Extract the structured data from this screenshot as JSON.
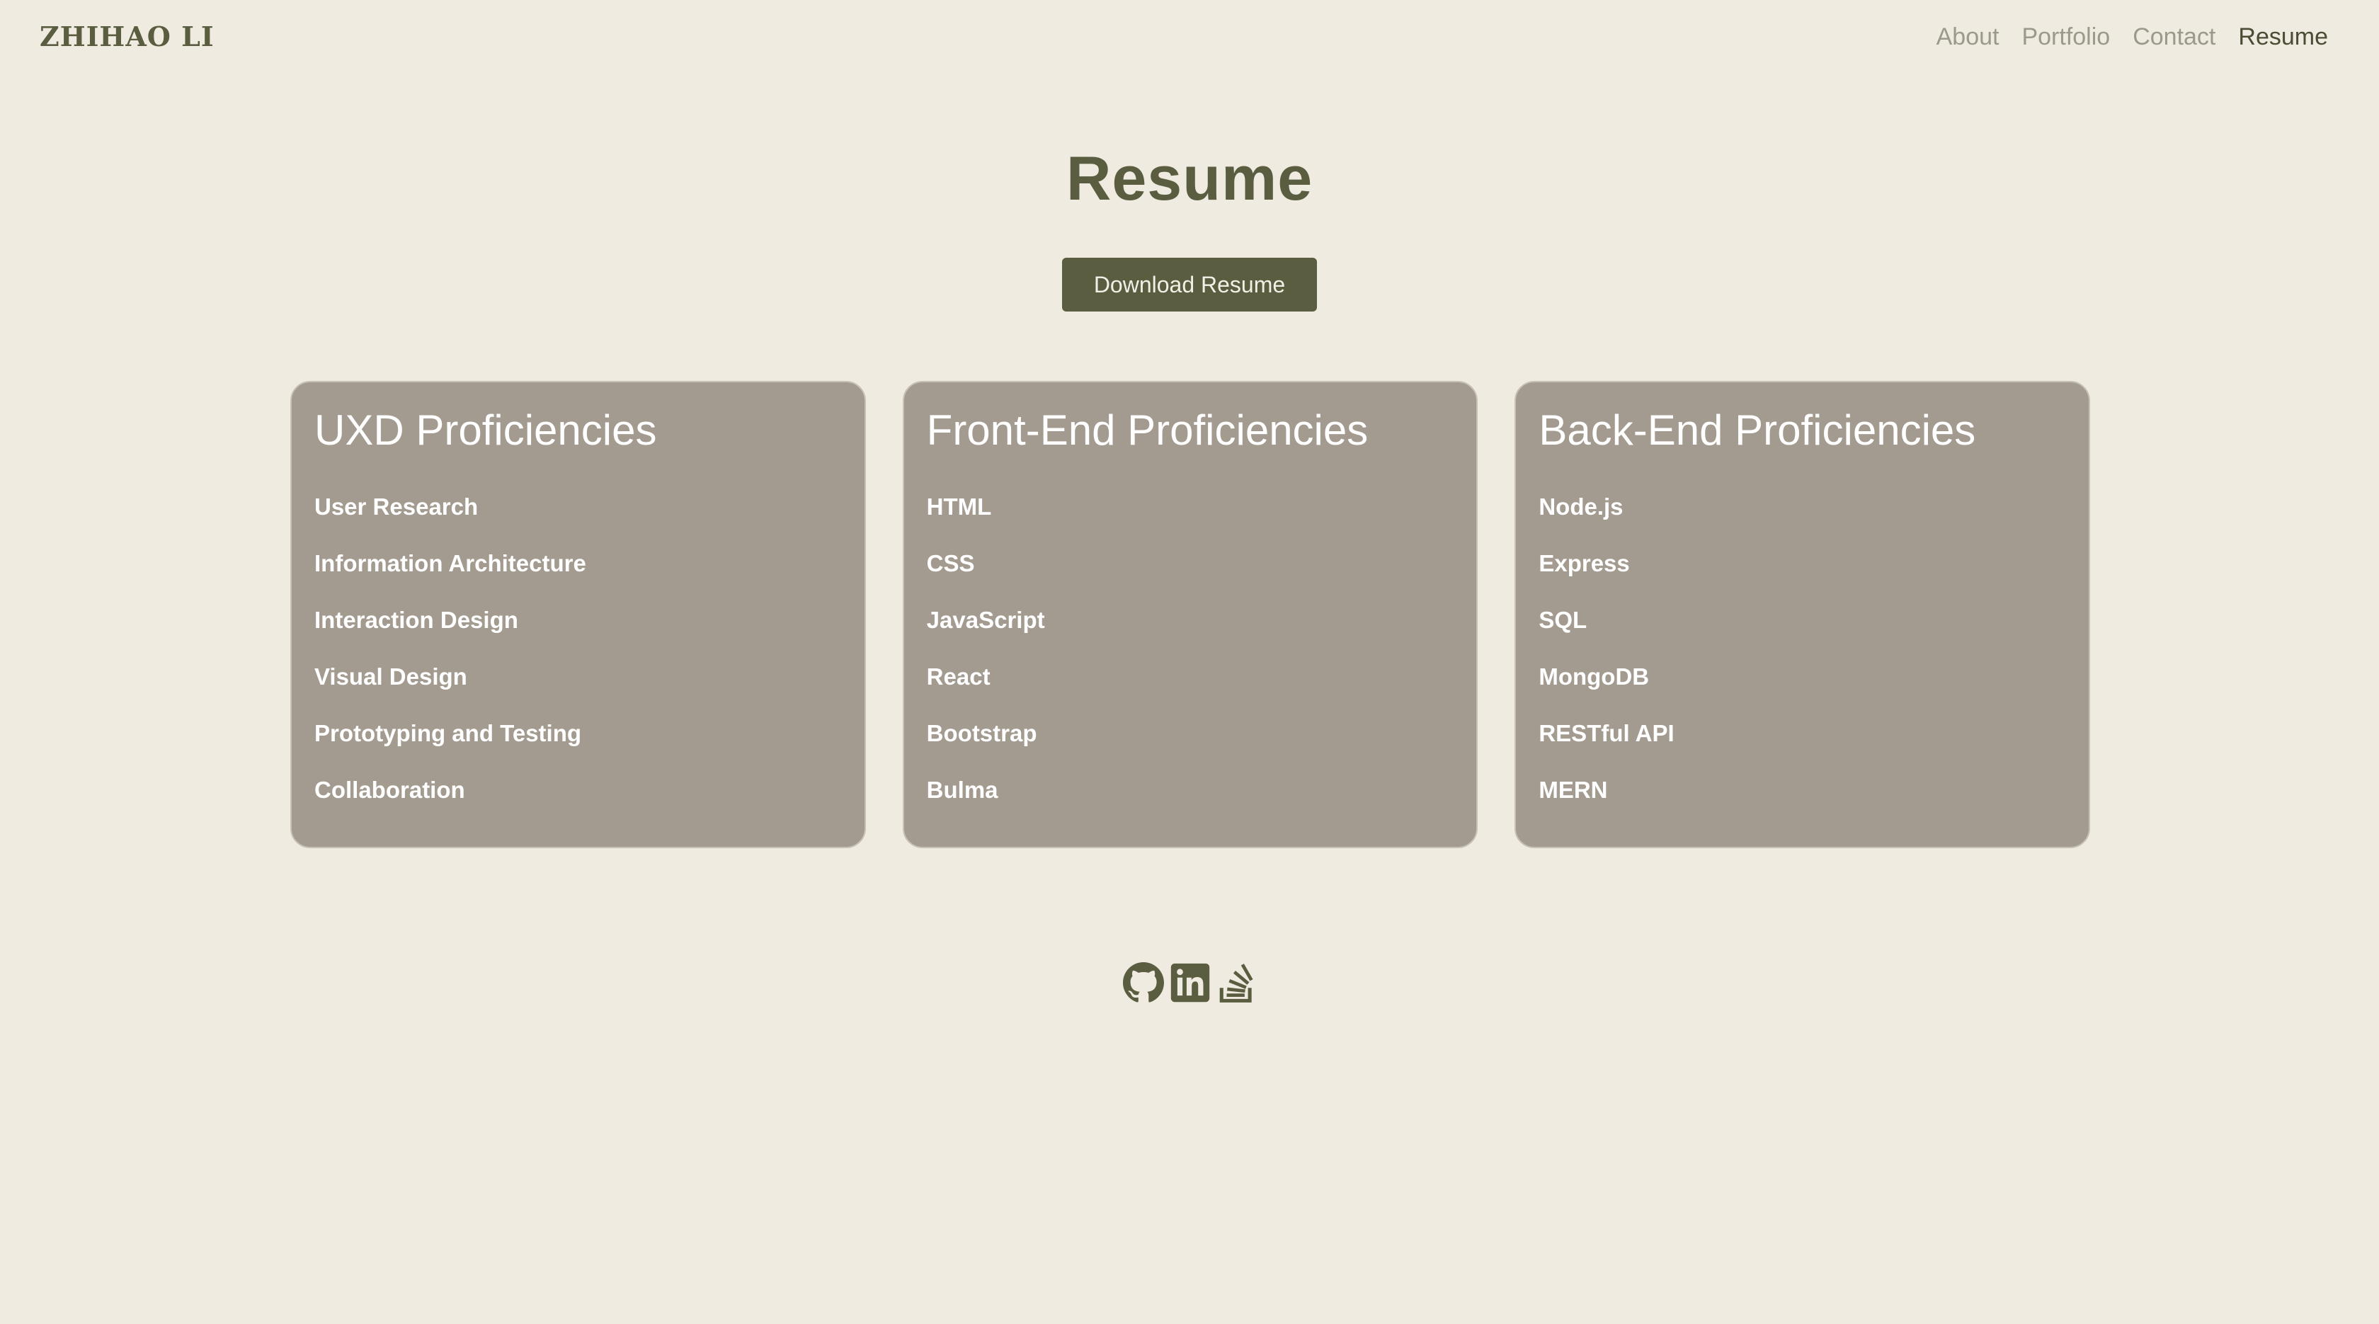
{
  "header": {
    "brand": "ZHIHAO LI",
    "nav": [
      {
        "label": "About",
        "active": false
      },
      {
        "label": "Portfolio",
        "active": false
      },
      {
        "label": "Contact",
        "active": false
      },
      {
        "label": "Resume",
        "active": true
      }
    ]
  },
  "main": {
    "title": "Resume",
    "download_label": "Download Resume",
    "cards": [
      {
        "title": "UXD Proficiencies",
        "items": [
          "User Research",
          "Information Architecture",
          "Interaction Design",
          "Visual Design",
          "Prototyping and Testing",
          "Collaboration"
        ]
      },
      {
        "title": "Front-End Proficiencies",
        "items": [
          "HTML",
          "CSS",
          "JavaScript",
          "React",
          "Bootstrap",
          "Bulma"
        ]
      },
      {
        "title": "Back-End Proficiencies",
        "items": [
          "Node.js",
          "Express",
          "SQL",
          "MongoDB",
          "RESTful API",
          "MERN"
        ]
      }
    ]
  },
  "footer": {
    "icons": [
      "github-icon",
      "linkedin-icon",
      "stackoverflow-icon"
    ]
  },
  "colors": {
    "background": "#efebe0",
    "accent": "#5a5d3f",
    "card": "#a49b90",
    "nav_inactive": "#9a9a8a"
  }
}
